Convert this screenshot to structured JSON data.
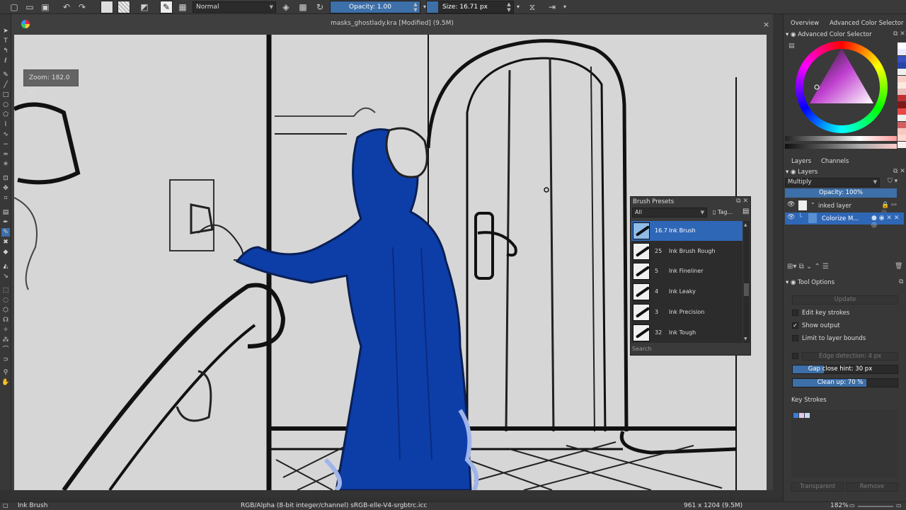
{
  "toolbar": {
    "blend_mode": "Normal",
    "opacity_label": "Opacity:  1.00",
    "opacity_fraction": 1.0,
    "size_label": "Size:  16.71 px",
    "size_fraction": 0.13
  },
  "canvas": {
    "title": "masks_ghostlady.kra [Modified]  (9.5M)",
    "close": "×",
    "zoom_popup": "Zoom:  182.0 %"
  },
  "brush_presets": {
    "title": "Brush Presets",
    "filter": "All",
    "tag_label": "Tag...",
    "search_placeholder": "Search",
    "items": [
      {
        "size": "16.7",
        "name": "Ink Brush",
        "selected": true
      },
      {
        "size": "25",
        "name": "Ink Brush Rough",
        "selected": false
      },
      {
        "size": "5",
        "name": "Ink Fineliner",
        "selected": false
      },
      {
        "size": "4",
        "name": "Ink Leaky",
        "selected": false
      },
      {
        "size": "3",
        "name": "Ink Precision",
        "selected": false
      },
      {
        "size": "32",
        "name": "Ink Tough",
        "selected": false
      }
    ]
  },
  "dock": {
    "tabs_top": [
      "Overview",
      "Advanced Color Selector"
    ],
    "color_selector_header": "Advanced Color Selector",
    "tabs_layers": [
      "Layers",
      "Channels"
    ],
    "layers_header": "Layers",
    "layer_blend": "Multiply",
    "layer_opacity": "Opacity:  100%",
    "layer_opacity_fraction": 1.0,
    "layers": [
      {
        "name": "inked layer",
        "selected": false
      },
      {
        "name": "Colorize M...",
        "selected": true
      }
    ],
    "tool_options_header": "Tool Options",
    "update_button": "Update",
    "options": [
      {
        "label": "Edit key strokes",
        "checked": false
      },
      {
        "label": "Show output",
        "checked": true
      },
      {
        "label": "Limit to layer bounds",
        "checked": false
      }
    ],
    "edge_detection": "Edge detection:  4 px",
    "gap_close": "Gap close hint:  30 px",
    "gap_close_fraction": 0.3,
    "clean_up": "Clean up:  70 %",
    "clean_up_fraction": 0.7,
    "key_strokes_label": "Key Strokes",
    "key_stroke_colors": [
      "#3d7ad6",
      "#e0c8e8",
      "#c8d8f0"
    ],
    "transparent_button": "Transparent",
    "remove_button": "Remove",
    "history_colors": [
      "#ffffff",
      "#e8e8ff",
      "#3a50c0",
      "#2844a8",
      "#f0f0f0",
      "#f8d0c8",
      "#ffe8e0",
      "#e8c0c0",
      "#c03030",
      "#801818",
      "#e84848",
      "#f0f0f0",
      "#d06060",
      "#f8c8c0",
      "#ffd8d0",
      "#f8f0f0"
    ]
  },
  "status": {
    "brush": "Ink Brush",
    "color_space": "RGB/Alpha (8-bit integer/channel)  sRGB-elle-V4-srgbtrc.icc",
    "dimensions": "961 x 1204 (9.5M)",
    "zoom": "182%"
  },
  "colors": {
    "accent": "#3d6fa8",
    "selection": "#2f67b7",
    "colorize_blue": "#0d3ea8"
  }
}
